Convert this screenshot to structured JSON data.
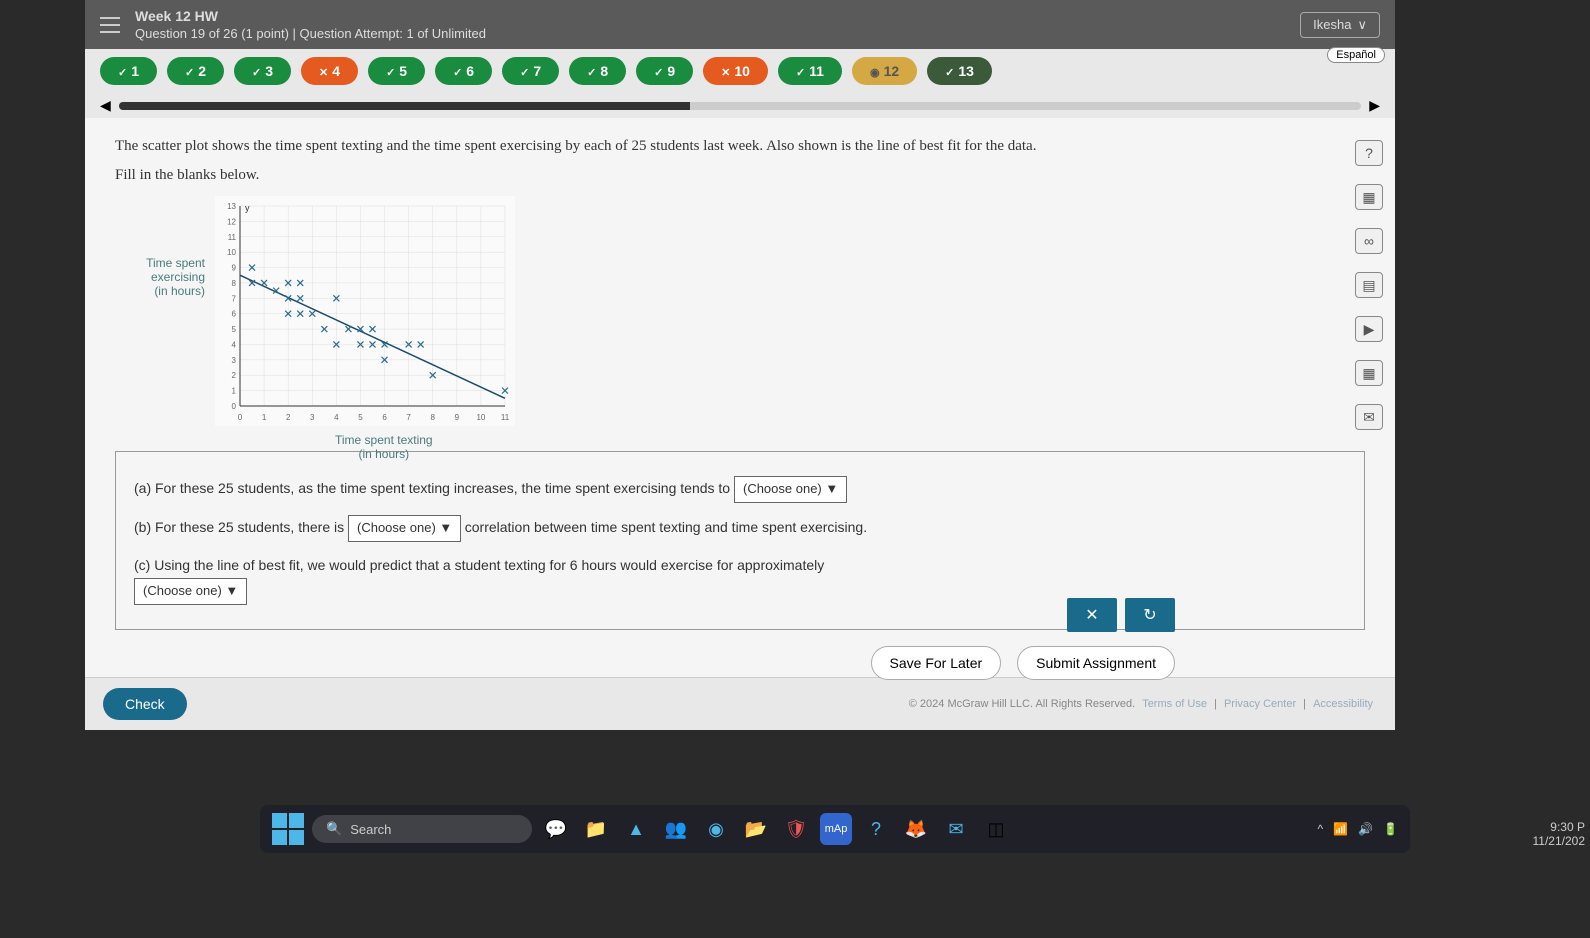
{
  "header": {
    "title": "Week 12 HW",
    "subtitle": "Question 19 of 26 (1 point)  |  Question Attempt: 1 of Unlimited",
    "user": "Ikesha"
  },
  "nav": {
    "espanol": "Español",
    "pills": [
      {
        "num": "1",
        "state": "check",
        "cls": "green"
      },
      {
        "num": "2",
        "state": "check",
        "cls": "green"
      },
      {
        "num": "3",
        "state": "check",
        "cls": "green"
      },
      {
        "num": "4",
        "state": "x",
        "cls": "red"
      },
      {
        "num": "5",
        "state": "check",
        "cls": "green"
      },
      {
        "num": "6",
        "state": "check",
        "cls": "green"
      },
      {
        "num": "7",
        "state": "check",
        "cls": "green"
      },
      {
        "num": "8",
        "state": "check",
        "cls": "green"
      },
      {
        "num": "9",
        "state": "check",
        "cls": "green"
      },
      {
        "num": "10",
        "state": "x",
        "cls": "red"
      },
      {
        "num": "11",
        "state": "check",
        "cls": "green"
      },
      {
        "num": "12",
        "state": "dot",
        "cls": "amber"
      },
      {
        "num": "13",
        "state": "check",
        "cls": "dark"
      }
    ]
  },
  "content": {
    "intro": "The scatter plot shows the time spent texting and the time spent exercising by each of 25 students last week. Also shown is the line of best fit for the data.",
    "instruction": "Fill in the blanks below.",
    "ylabel1": "Time spent",
    "ylabel2": "exercising",
    "ylabel3": "(in hours)",
    "xlabel1": "Time spent texting",
    "xlabel2": "(in hours)"
  },
  "chart_data": {
    "type": "scatter",
    "title": "",
    "xlabel": "Time spent texting (in hours)",
    "ylabel": "Time spent exercising (in hours)",
    "xlim": [
      0,
      11
    ],
    "ylim": [
      0,
      13
    ],
    "x_ticks": [
      0,
      1,
      2,
      3,
      4,
      5,
      6,
      7,
      8,
      9,
      10,
      11
    ],
    "y_ticks": [
      0,
      1,
      2,
      3,
      4,
      5,
      6,
      7,
      8,
      9,
      10,
      11,
      12,
      13
    ],
    "points": [
      {
        "x": 0.5,
        "y": 9
      },
      {
        "x": 0.5,
        "y": 8
      },
      {
        "x": 1,
        "y": 8
      },
      {
        "x": 1.5,
        "y": 7.5
      },
      {
        "x": 2,
        "y": 7
      },
      {
        "x": 2,
        "y": 8
      },
      {
        "x": 2.5,
        "y": 8
      },
      {
        "x": 2,
        "y": 6
      },
      {
        "x": 2.5,
        "y": 7
      },
      {
        "x": 3,
        "y": 6
      },
      {
        "x": 2.5,
        "y": 6
      },
      {
        "x": 4,
        "y": 7
      },
      {
        "x": 3.5,
        "y": 5
      },
      {
        "x": 4.5,
        "y": 5
      },
      {
        "x": 4,
        "y": 4
      },
      {
        "x": 5,
        "y": 5
      },
      {
        "x": 5.5,
        "y": 5
      },
      {
        "x": 5,
        "y": 4
      },
      {
        "x": 5.5,
        "y": 4
      },
      {
        "x": 6,
        "y": 4
      },
      {
        "x": 6,
        "y": 3
      },
      {
        "x": 7,
        "y": 4
      },
      {
        "x": 7.5,
        "y": 4
      },
      {
        "x": 8,
        "y": 2
      },
      {
        "x": 11,
        "y": 1
      }
    ],
    "best_fit_line": {
      "x1": 0,
      "y1": 8.5,
      "x2": 11,
      "y2": 0.5
    }
  },
  "questions": {
    "a_pre": "(a) For these 25 students, as the time spent texting increases, the time spent exercising tends to ",
    "a_choose": "(Choose one)   ▼",
    "b_pre": "(b) For these 25 students, there is ",
    "b_choose": "(Choose one)  ▼",
    "b_post": " correlation between time spent texting and time spent exercising.",
    "c_pre": "(c) Using the line of best fit, we would predict that a student texting for 6 hours would exercise for approximately",
    "c_choose": "(Choose one)  ▼"
  },
  "buttons": {
    "clear": "✕",
    "reset": "↻",
    "check": "Check",
    "save": "Save For Later",
    "submit": "Submit Assignment"
  },
  "footer": {
    "copyright": "© 2024 McGraw Hill LLC. All Rights Reserved.",
    "terms": "Terms of Use",
    "privacy": "Privacy Center",
    "accessibility": "Accessibility"
  },
  "tools": {
    "help": "?",
    "calc": "▦",
    "inf": "∞",
    "notes": "▤",
    "play": "▶",
    "grid": "▦",
    "mail": "✉"
  },
  "taskbar": {
    "search": "Search"
  },
  "clock": {
    "time": "9:30 P",
    "date": "11/21/202"
  }
}
